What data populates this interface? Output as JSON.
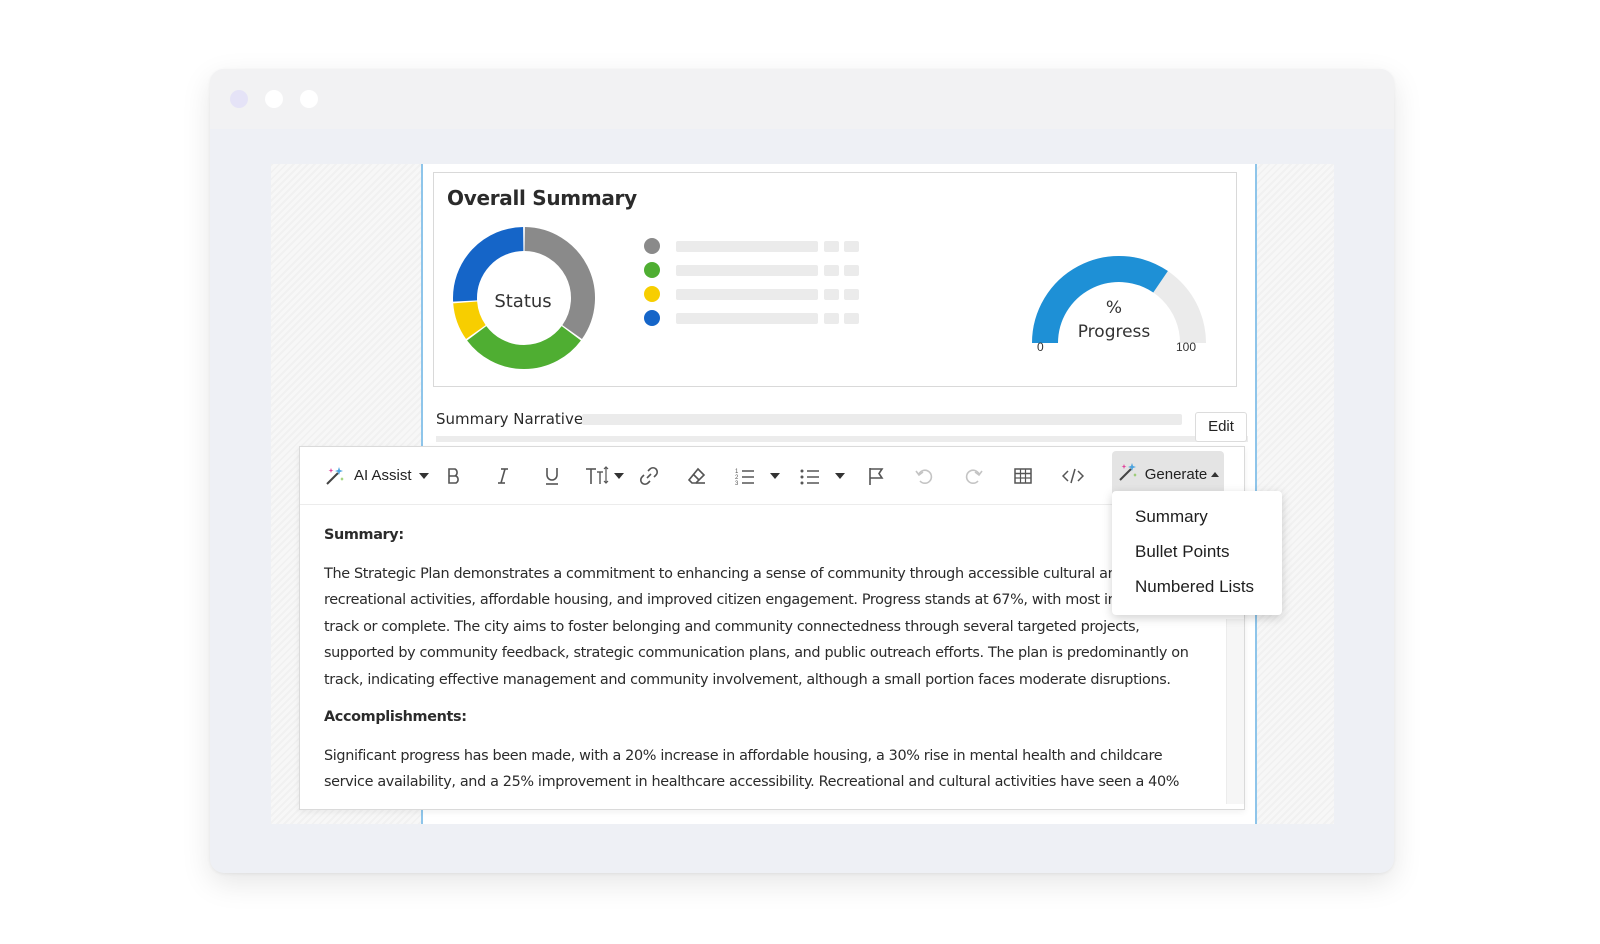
{
  "window": {
    "controls": [
      "close",
      "minimize",
      "maximize"
    ]
  },
  "summary_card": {
    "title": "Overall Summary",
    "donut": {
      "label": "Status",
      "segments": [
        {
          "color": "#8a8a8a",
          "value": 35
        },
        {
          "color": "#4fae32",
          "value": 30
        },
        {
          "color": "#f7ce00",
          "value": 9
        },
        {
          "color": "#1565c8",
          "value": 26
        }
      ]
    },
    "legend_colors": [
      "#8a8a8a",
      "#4fae32",
      "#f7ce00",
      "#1565c8"
    ],
    "gauge": {
      "label_line1": "%",
      "label_line2": "Progress",
      "min": "0",
      "max": "100",
      "value_fraction": 0.69,
      "fill_color": "#1e90d6",
      "track_color": "#ebebeb"
    }
  },
  "narrative": {
    "label": "Summary Narrative",
    "edit_label": "Edit"
  },
  "toolbar": {
    "ai_assist_label": "AI Assist",
    "generate_label": "Generate",
    "icons": [
      "magic-wand-icon",
      "bold-icon",
      "italic-icon",
      "underline-icon",
      "text-size-icon",
      "link-icon",
      "eraser-icon",
      "numbered-list-icon",
      "bullet-list-icon",
      "flag-icon",
      "undo-icon",
      "redo-icon",
      "table-icon",
      "code-icon"
    ]
  },
  "generate_menu": {
    "items": [
      "Summary",
      "Bullet Points",
      "Numbered Lists"
    ]
  },
  "content": {
    "summary_heading": "Summary:",
    "summary_lines": [
      "The Strategic Plan demonstrates a commitment to enhancing a sense of community through accessible cultural and",
      "recreational activities, affordable housing, and improved citizen engagement. Progress stands at 67%, with most initiatives on",
      "track or complete. The city aims to foster belonging and community connectedness through several targeted projects,",
      "supported by community feedback, strategic communication plans, and public outreach efforts. The plan is predominantly on",
      "track, indicating effective management and community involvement, although a small portion faces moderate disruptions."
    ],
    "accomplishments_heading": "Accomplishments:",
    "accomplishments_lines": [
      "Significant progress has been made, with a 20% increase in affordable housing, a 30% rise in mental health and childcare",
      "service availability, and a 25% improvement in healthcare accessibility. Recreational and cultural activities have seen a 40%"
    ]
  }
}
